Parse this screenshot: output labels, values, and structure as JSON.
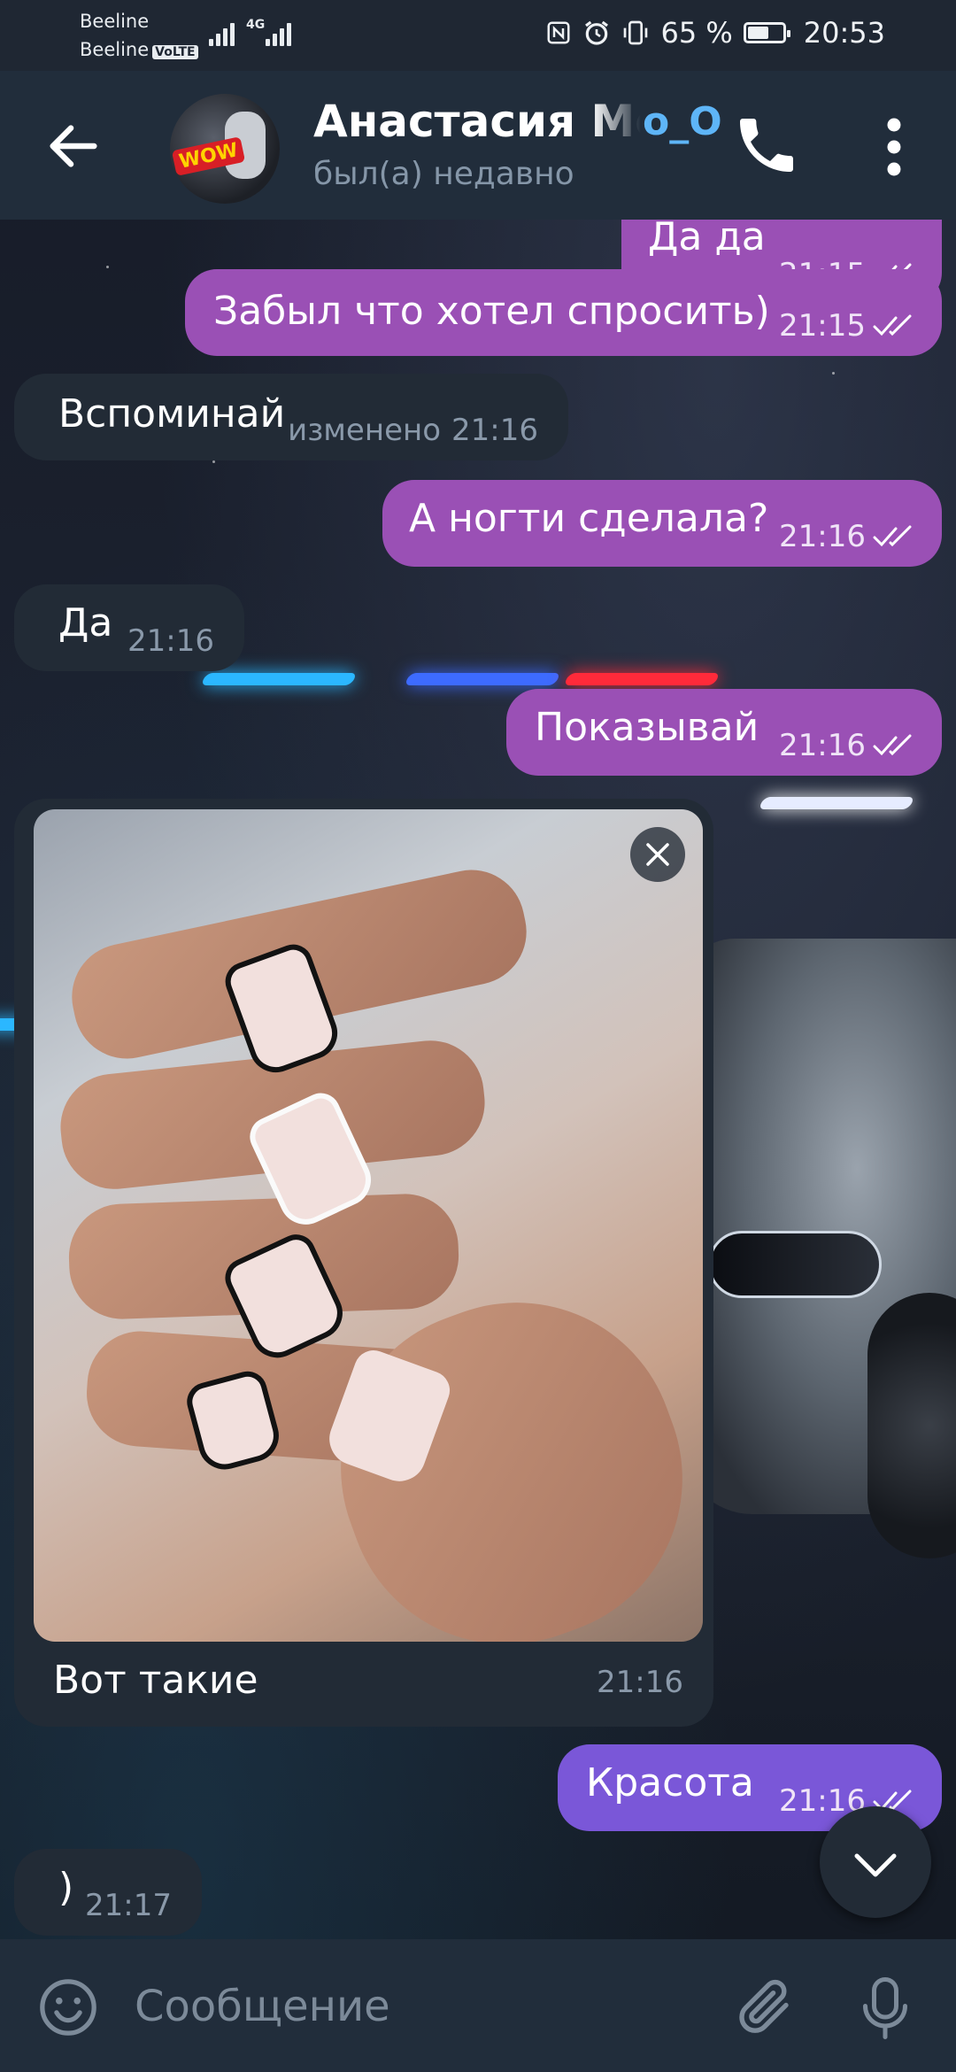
{
  "status_bar": {
    "carrier_1": "Beeline",
    "carrier_2": "Beeline",
    "volte": "VoLTE",
    "network": "4G",
    "battery": "65 %",
    "battery_level": 0.65,
    "time": "20:53"
  },
  "header": {
    "name": "Анастасия Ме",
    "emoji": "o_O",
    "status": "был(а) недавно"
  },
  "messages": [
    {
      "dir": "out",
      "text": "Да да",
      "time": "21:15"
    },
    {
      "dir": "out",
      "text": "Забыл что хотел спросить)",
      "time": "21:15"
    },
    {
      "dir": "in",
      "text": "Вспоминай",
      "edited": "изменено",
      "time": "21:16"
    },
    {
      "dir": "out",
      "text": "А ногти сделала?",
      "time": "21:16"
    },
    {
      "dir": "in",
      "text": "Да",
      "time": "21:16"
    },
    {
      "dir": "out",
      "text": "Показывай",
      "time": "21:16"
    },
    {
      "dir": "in",
      "type": "photo",
      "caption": "Вот такие",
      "time": "21:16"
    },
    {
      "dir": "out",
      "text": "Красота",
      "time": "21:16"
    },
    {
      "dir": "in",
      "text": ")",
      "time": "21:17"
    }
  ],
  "input": {
    "placeholder": "Сообщение"
  },
  "colors": {
    "outgoing_bubble": "#9a50b5",
    "outgoing_bubble_alt": "#7a57d8",
    "incoming_bubble": "#222b36",
    "header": "#212d3b",
    "accent": "#5eb5f7"
  },
  "icons": {
    "back": "arrow-left-icon",
    "call": "phone-icon",
    "menu": "more-vertical-icon",
    "close": "close-icon",
    "scroll": "chevron-down-icon",
    "emoji": "smile-icon",
    "attach": "paperclip-icon",
    "mic": "microphone-icon"
  }
}
